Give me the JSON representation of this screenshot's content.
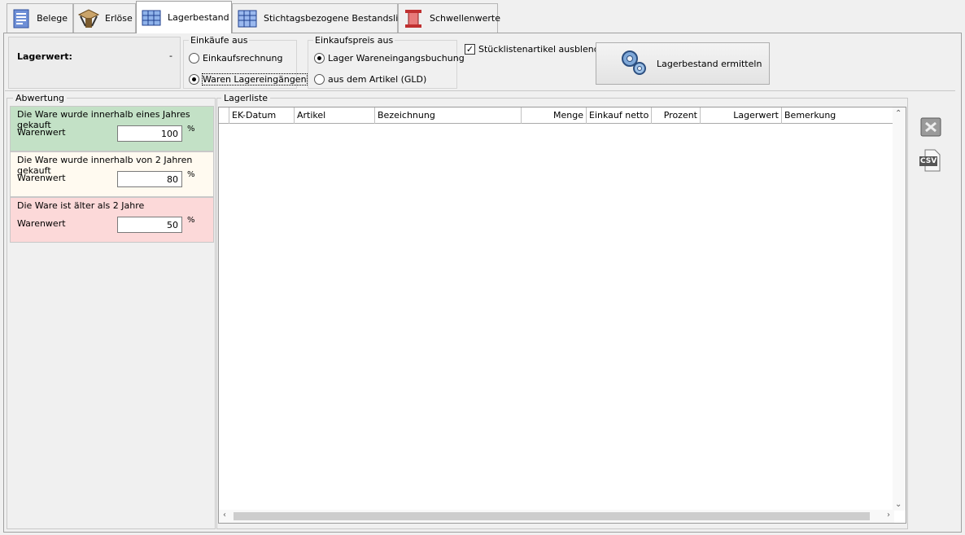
{
  "tabs": [
    {
      "label": "Belege"
    },
    {
      "label": "Erlöse"
    },
    {
      "label": "Lagerbestand"
    },
    {
      "label": "Stichtagsbezogene Bestandsliste"
    },
    {
      "label": "Schwellenwerte"
    }
  ],
  "top": {
    "lagerwert_label": "Lagerwert:",
    "lagerwert_value": "-",
    "einkaeufe": {
      "title": "Einkäufe aus",
      "options": [
        {
          "label": "Einkaufsrechnung",
          "selected": false
        },
        {
          "label": "Waren Lagereingängen",
          "selected": true
        }
      ]
    },
    "einkaufspreis": {
      "title": "Einkaufspreis aus",
      "options": [
        {
          "label": "Lager Wareneingangsbuchung",
          "selected": true
        },
        {
          "label": "aus dem Artikel (GLD)",
          "selected": false
        }
      ]
    },
    "stueckliste_label": "Stücklistenartikel ausblenden",
    "stueckliste_checked": true,
    "ermitteln_button": "Lagerbestand ermitteln"
  },
  "abwertung": {
    "title": "Abwertung",
    "boxes": [
      {
        "text": "Die Ware wurde innerhalb eines Jahres gekauft",
        "label": "Warenwert",
        "value": "100",
        "unit": "%",
        "color": "#c3e1c6"
      },
      {
        "text": "Die Ware wurde innerhalb von 2 Jahren gekauft",
        "label": "Warenwert",
        "value": "80",
        "unit": "%",
        "color": "#fffaf0"
      },
      {
        "text": "Die Ware ist älter als 2 Jahre",
        "label": "Warenwert",
        "value": "50",
        "unit": "%",
        "color": "#fcd9d9"
      }
    ]
  },
  "lagerliste": {
    "title": "Lagerliste",
    "columns": [
      "EK-Datum",
      "Artikel",
      "Bezeichnung",
      "Menge",
      "Einkauf netto",
      "Prozent",
      "Lagerwert",
      "Bemerkung"
    ],
    "rows": []
  },
  "export": {
    "excel_icon": "excel-export-icon",
    "csv_icon": "csv-export-icon",
    "csv_label": "CSV"
  }
}
